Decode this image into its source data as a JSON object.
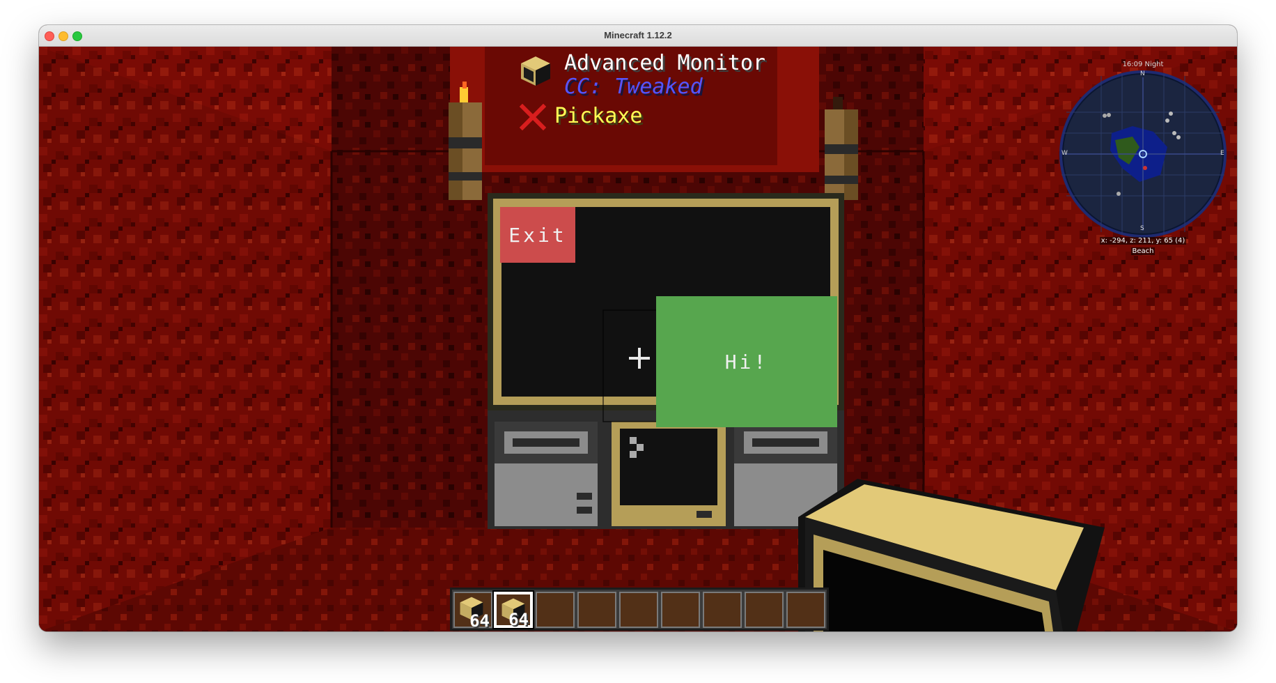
{
  "window": {
    "title": "Minecraft 1.12.2"
  },
  "tooltip": {
    "block_name": "Advanced Monitor",
    "mod_name": "CC: Tweaked",
    "tool": "Pickaxe",
    "block_icon": "advanced-monitor-block-icon",
    "tool_status_icon": "red-x-icon"
  },
  "monitor_screen": {
    "exit_button": {
      "label": "Exit",
      "color": "#cc4c4c"
    },
    "hi_button": {
      "label": "Hi!",
      "color": "#57a64e"
    },
    "background": "#111111"
  },
  "minimap": {
    "time": "16:09 Night",
    "compass": {
      "north": "N",
      "south": "S",
      "east": "E",
      "west": "W"
    },
    "coordinates": "x: -294, z: 211, y: 65 (4)",
    "biome": "Beach"
  },
  "hotbar": {
    "slots": [
      {
        "count": "64",
        "item": "advanced-monitor-block-icon"
      },
      {
        "count": "64",
        "item": "advanced-monitor-block-icon",
        "selected": true
      },
      {
        "count": ""
      },
      {
        "count": ""
      },
      {
        "count": ""
      },
      {
        "count": ""
      },
      {
        "count": ""
      },
      {
        "count": ""
      },
      {
        "count": ""
      }
    ]
  }
}
